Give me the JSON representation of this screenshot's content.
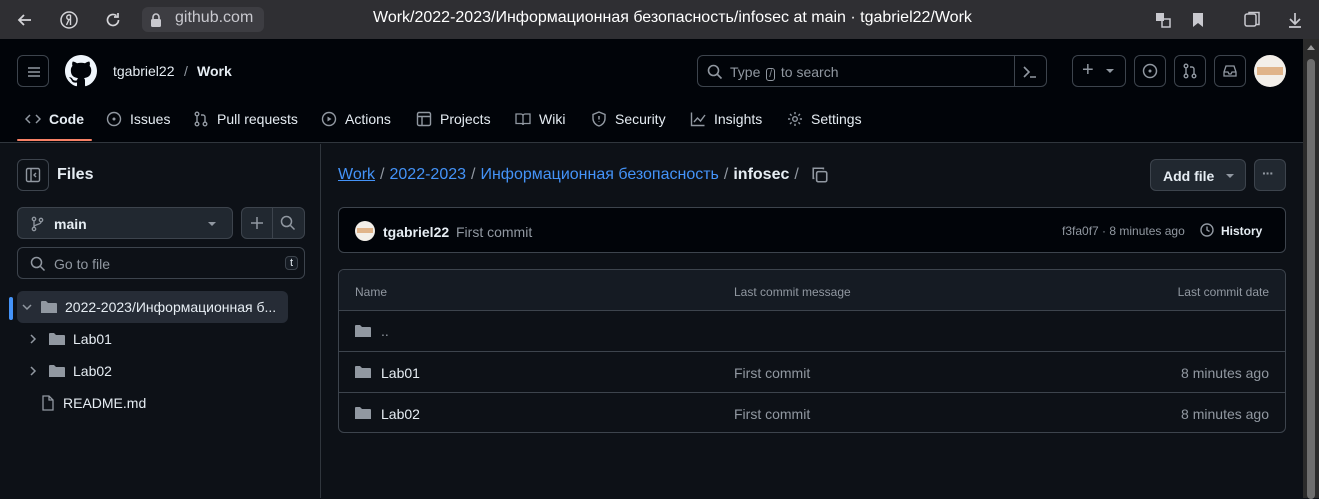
{
  "browser": {
    "url": "github.com",
    "title": "Work/2022-2023/Информационная безопасность/infosec at main · tgabriel22/Work"
  },
  "header": {
    "owner": "tgabriel22",
    "separator": "/",
    "repo": "Work",
    "search_prefix": "Type",
    "search_key": "/",
    "search_suffix": "to search",
    "plus": "+"
  },
  "tabs": [
    {
      "label": "Code",
      "icon": "code-icon"
    },
    {
      "label": "Issues",
      "icon": "issue-icon"
    },
    {
      "label": "Pull requests",
      "icon": "pull-request-icon"
    },
    {
      "label": "Actions",
      "icon": "play-icon"
    },
    {
      "label": "Projects",
      "icon": "table-icon"
    },
    {
      "label": "Wiki",
      "icon": "book-icon"
    },
    {
      "label": "Security",
      "icon": "shield-icon"
    },
    {
      "label": "Insights",
      "icon": "graph-icon"
    },
    {
      "label": "Settings",
      "icon": "gear-icon"
    }
  ],
  "sidebar": {
    "title": "Files",
    "branch": "main",
    "goto_placeholder": "Go to file",
    "goto_key": "t",
    "tree": [
      {
        "label": "2022-2023/Информационная б...",
        "type": "folder-open"
      },
      {
        "label": "Lab01",
        "type": "folder"
      },
      {
        "label": "Lab02",
        "type": "folder"
      },
      {
        "label": "README.md",
        "type": "file"
      }
    ]
  },
  "breadcrumb": {
    "parts": [
      "Work",
      "2022-2023",
      "Информационная безопасность"
    ],
    "current": "infosec",
    "trailing": "/"
  },
  "actions": {
    "add_file": "Add file",
    "more": "···"
  },
  "commit": {
    "author": "tgabriel22",
    "message": "First commit",
    "meta": "f3fa0f7 · 8 minutes ago",
    "history": "History"
  },
  "table": {
    "headers": {
      "name": "Name",
      "message": "Last commit message",
      "date": "Last commit date"
    },
    "parent": "..",
    "rows": [
      {
        "name": "Lab01",
        "message": "First commit",
        "date": "8 minutes ago"
      },
      {
        "name": "Lab02",
        "message": "First commit",
        "date": "8 minutes ago"
      }
    ]
  },
  "colors": {
    "background": "#0d1117",
    "header": "#010409",
    "accent_link": "#4493f8",
    "tab_underline": "#f78166",
    "border": "#3d444d"
  }
}
